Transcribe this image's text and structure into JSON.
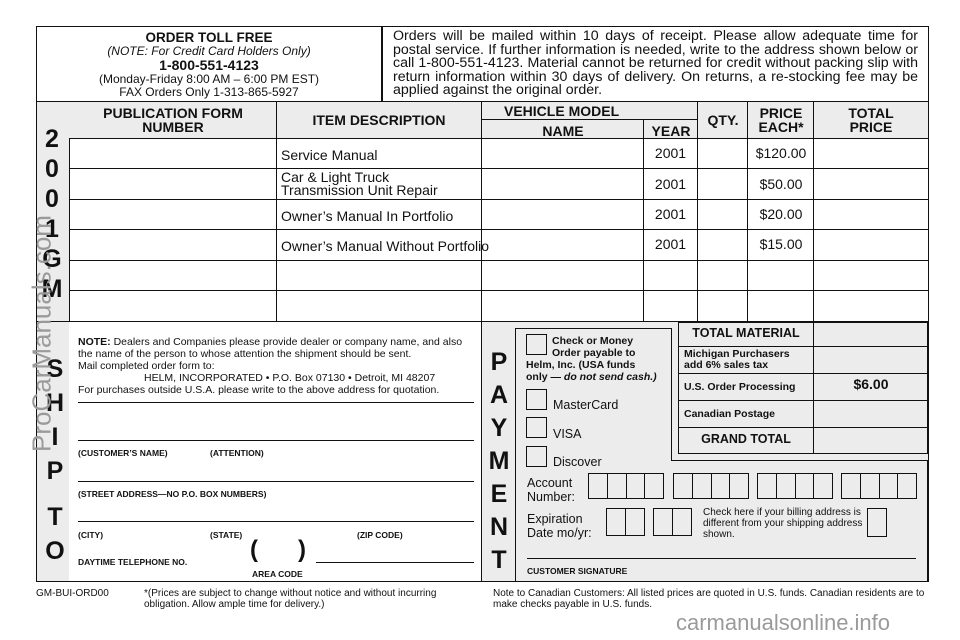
{
  "order_info": {
    "title": "ORDER TOLL FREE",
    "note": "(NOTE: For Credit Card Holders Only)",
    "phone": "1-800-551-4123",
    "hours": "(Monday-Friday 8:00 AM – 6:00 PM EST)",
    "fax": "FAX Orders Only 1-313-865-5927"
  },
  "mailing_policy": "Orders will be mailed within 10 days of receipt. Please allow adequate time for postal service. If further information is needed, write to the address shown below or call 1-800-551-4123. Material cannot be returned for credit without packing slip with return information within 30 days of delivery. On returns, a re-stocking fee may be applied against the original order.",
  "side_label_top": [
    "2",
    "0",
    "0",
    "1",
    "G",
    "M"
  ],
  "side_label_ship": [
    "S",
    "H",
    "I",
    "P",
    "T",
    "O"
  ],
  "side_label_payment": [
    "P",
    "A",
    "Y",
    "M",
    "E",
    "N",
    "T"
  ],
  "table": {
    "headers": {
      "pub_form_line1": "PUBLICATION FORM",
      "pub_form_line2": "NUMBER",
      "item_description": "ITEM DESCRIPTION",
      "vehicle_model": "VEHICLE MODEL",
      "name": "NAME",
      "year": "YEAR",
      "qty": "QTY.",
      "price_each_line1": "PRICE",
      "price_each_line2": "EACH*",
      "total_price_line1": "TOTAL",
      "total_price_line2": "PRICE"
    },
    "rows": [
      {
        "pub_form": "",
        "desc_line1": "Service Manual",
        "desc_line2": "",
        "name": "",
        "year": "2001",
        "qty": "",
        "price": "$120.00",
        "total": ""
      },
      {
        "pub_form": "",
        "desc_line1": "Car & Light Truck",
        "desc_line2": "Transmission Unit Repair",
        "name": "",
        "year": "2001",
        "qty": "",
        "price": "$50.00",
        "total": ""
      },
      {
        "pub_form": "",
        "desc_line1": "Owner’s Manual In Portfolio",
        "desc_line2": "",
        "name": "",
        "year": "2001",
        "qty": "",
        "price": "$20.00",
        "total": ""
      },
      {
        "pub_form": "",
        "desc_line1": "Owner’s Manual Without Portfolio",
        "desc_line2": "",
        "name": "",
        "year": "2001",
        "qty": "",
        "price": "$15.00",
        "total": ""
      },
      {
        "pub_form": "",
        "desc_line1": "",
        "desc_line2": "",
        "name": "",
        "year": "",
        "qty": "",
        "price": "",
        "total": ""
      },
      {
        "pub_form": "",
        "desc_line1": "",
        "desc_line2": "",
        "name": "",
        "year": "",
        "qty": "",
        "price": "",
        "total": ""
      }
    ]
  },
  "ship_to": {
    "note_bold": "NOTE:",
    "note_text": " Dealers and Companies please provide dealer or company name, and also the name of the person to whose attention the shipment should be sent.",
    "mail_to_label": "Mail completed order form to:",
    "address": "HELM, INCORPORATED • P.O. Box 07130 • Detroit, MI 48207",
    "outside_usa": "For purchases outside U.S.A. please write to the above address for quotation.",
    "customer_name_label": "(CUSTOMER’S NAME)",
    "attention_label": "(ATTENTION)",
    "street_label": "(STREET ADDRESS—NO P.O. BOX NUMBERS)",
    "city_label": "(CITY)",
    "state_label": "(STATE)",
    "zip_label": "(ZIP CODE)",
    "phone_label": "DAYTIME TELEPHONE NO.",
    "paren_open": "(",
    "paren_close": ")",
    "area_code_label": "AREA CODE"
  },
  "payment": {
    "check_line1": "Check or Money",
    "check_line2": "Order payable to",
    "check_line3": "Helm, Inc. (USA funds",
    "check_line4a": "only — ",
    "check_line4b": "do not send cash.)",
    "mastercard": "MasterCard",
    "visa": "VISA",
    "discover": "Discover",
    "account_line1": "Account",
    "account_line2": "Number:",
    "exp_line1": "Expiration",
    "exp_line2": "Date mo/yr:",
    "billing_note": "Check here if your billing address is different from your shipping address shown.",
    "signature_label": "CUSTOMER SIGNATURE"
  },
  "totals": [
    {
      "label": "TOTAL MATERIAL",
      "value": "",
      "style": "big"
    },
    {
      "label": "Michigan Purchasers add 6% sales tax",
      "value": "",
      "style": "small"
    },
    {
      "label": "U.S. Order Processing",
      "value": "$6.00",
      "style": "small"
    },
    {
      "label": "Canadian Postage",
      "value": "",
      "style": "small"
    },
    {
      "label": "GRAND TOTAL",
      "value": "",
      "style": "big"
    }
  ],
  "footer": {
    "form_code": "GM-BUI-ORD00",
    "price_note": "*(Prices are subject to change without notice and without incurring obligation. Allow ample time for delivery.)",
    "canada_note": "Note to Canadian Customers: All listed prices are quoted in U.S. funds. Canadian residents are to make checks payable in U.S. funds."
  },
  "watermarks": {
    "side": "ProCarManuals.com",
    "bottom": "carmanualsonline.info"
  }
}
